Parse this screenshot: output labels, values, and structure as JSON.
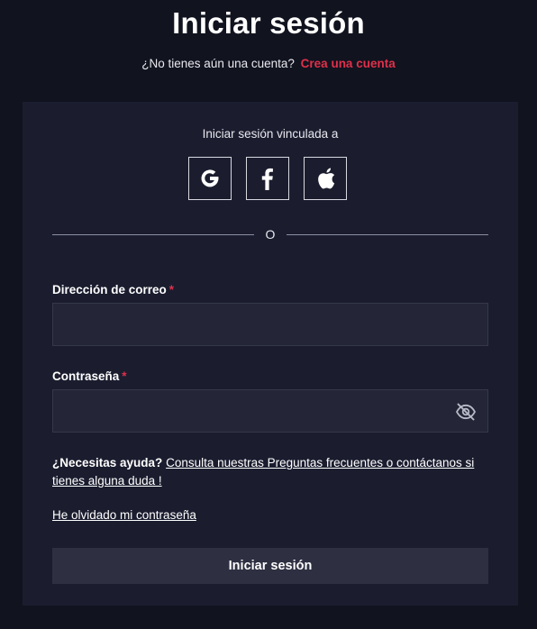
{
  "page": {
    "title": "Iniciar sesión",
    "signup_prompt": "¿No tienes aún una cuenta?",
    "signup_link": "Crea una cuenta"
  },
  "social": {
    "label": "Iniciar sesión vinculada a",
    "providers": [
      {
        "name": "Google",
        "icon": "google-icon"
      },
      {
        "name": "Facebook",
        "icon": "facebook-icon"
      },
      {
        "name": "Apple",
        "icon": "apple-icon"
      }
    ]
  },
  "divider": {
    "text": "O"
  },
  "form": {
    "email": {
      "label": "Dirección de correo",
      "required_mark": "*",
      "value": "",
      "placeholder": ""
    },
    "password": {
      "label": "Contraseña",
      "required_mark": "*",
      "value": "",
      "placeholder": "",
      "toggle_icon": "eye-off-icon"
    }
  },
  "help": {
    "strong": "¿Necesitas ayuda?",
    "link": "Consulta nuestras Preguntas frecuentes o contáctanos si tienes alguna duda !"
  },
  "forgot_password": "He olvidado mi contraseña",
  "submit_label": "Iniciar sesión",
  "colors": {
    "background": "#11131f",
    "card": "#1b1d2f",
    "accent": "#e0304a",
    "input": "#242637",
    "button": "#2e3042"
  }
}
